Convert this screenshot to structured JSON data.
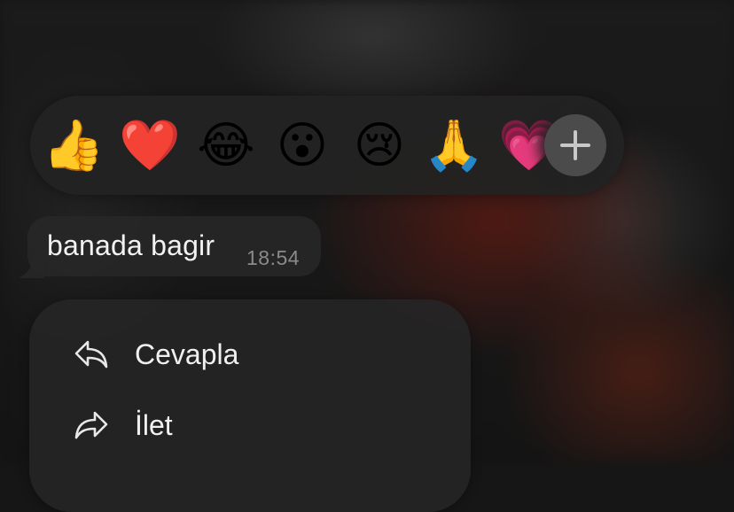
{
  "reactions": {
    "items": [
      {
        "name": "thumbs-up",
        "glyph": "👍"
      },
      {
        "name": "red-heart",
        "glyph": "❤️"
      },
      {
        "name": "tears-of-joy",
        "glyph": "😂"
      },
      {
        "name": "astonished",
        "glyph": "😮"
      },
      {
        "name": "crying",
        "glyph": "😢"
      },
      {
        "name": "folded-hands",
        "glyph": "🙏"
      },
      {
        "name": "growing-heart",
        "glyph": "💗"
      }
    ],
    "more_icon": "plus-icon"
  },
  "message": {
    "text": "banada bagir",
    "time": "18:54"
  },
  "menu": {
    "items": [
      {
        "label": "Cevapla",
        "icon": "reply-icon"
      },
      {
        "label": "İlet",
        "icon": "forward-icon"
      }
    ]
  },
  "colors": {
    "bubble": "#262626",
    "reaction_bar": "#222222",
    "add_button": "#4b4b4b",
    "text": "#f2f2f2",
    "timestamp": "#8a8a8a"
  }
}
